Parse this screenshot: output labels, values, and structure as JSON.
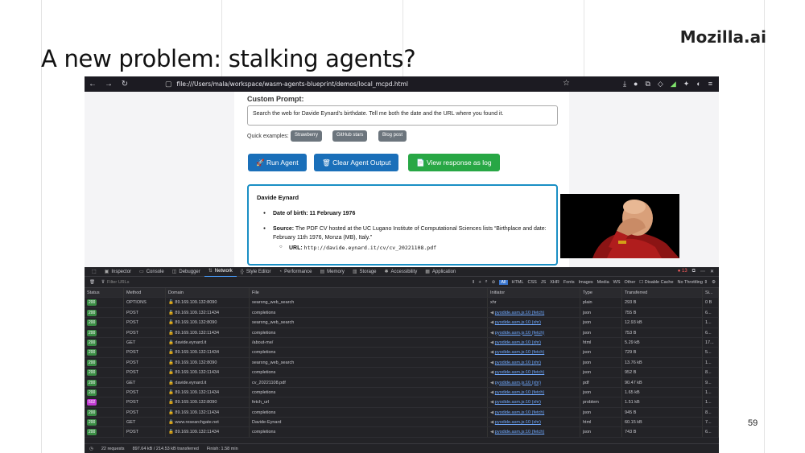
{
  "slide": {
    "title": "A new problem: stalking agents?",
    "logo": "Mozilla.ai",
    "page_number": "59"
  },
  "browser": {
    "url": "file:///Users/mala/workspace/wasm-agents-blueprint/demos/local_mcpd.html"
  },
  "app": {
    "prompt_label": "Custom Prompt:",
    "prompt_value": "Search the web for Davide Eynard's birthdate. Tell me both the date and the URL where you found it.",
    "quick_label": "Quick examples:",
    "quick_examples": [
      "Strawberry",
      "GitHub stars",
      "Blog post"
    ],
    "run_agent": "🚀 Run Agent",
    "clear_output": "🗑 Clear Agent Output",
    "view_log": "📄 View response as log",
    "output": {
      "name": "Davide Eynard",
      "dob_label": "Date of birth:",
      "dob_value": "11 February 1976",
      "source_label": "Source:",
      "source_text": "The PDF CV hosted at the UC Lugano Institute of Computational Sciences lists “Birthplace and date: February 11th 1976, Monza (MB), Italy.”",
      "url_label": "URL:",
      "url_value": "http://davide.eynard.it/cv/cv_20221108.pdf"
    }
  },
  "devtools": {
    "tabs": [
      "Inspector",
      "Console",
      "Debugger",
      "Network",
      "Style Editor",
      "Performance",
      "Memory",
      "Storage",
      "Accessibility",
      "Application"
    ],
    "active_tab": "Network",
    "error_count": "13",
    "filter_placeholder": "Filter URLs",
    "filter_types": [
      "All",
      "HTML",
      "CSS",
      "JS",
      "XHR",
      "Fonts",
      "Images",
      "Media",
      "WS",
      "Other"
    ],
    "disable_cache": "Disable Cache",
    "throttling": "No Throttling ⇕",
    "columns": [
      "Status",
      "Method",
      "Domain",
      "File",
      "Initiator",
      "Type",
      "Transferred",
      "Si..."
    ],
    "rows": [
      {
        "status": "200",
        "method": "OPTIONS",
        "domain": "89.169.109.132:8090",
        "file": "searxng_web_search",
        "initiator": "xhr",
        "type": "plain",
        "transferred": "293 B",
        "size": "0 B"
      },
      {
        "status": "200",
        "method": "POST",
        "domain": "89.169.109.132:11434",
        "file": "completions",
        "initiator": "pyodide.asm.js:10 (fetch)",
        "type": "json",
        "transferred": "755 B",
        "size": "6..."
      },
      {
        "status": "200",
        "method": "POST",
        "domain": "89.169.109.132:8090",
        "file": "searxng_web_search",
        "initiator": "pyodide.asm.js:10 (xhr)",
        "type": "json",
        "transferred": "12.93 kB",
        "size": "1..."
      },
      {
        "status": "200",
        "method": "POST",
        "domain": "89.169.109.132:11434",
        "file": "completions",
        "initiator": "pyodide.asm.js:10 (fetch)",
        "type": "json",
        "transferred": "753 B",
        "size": "6..."
      },
      {
        "status": "200",
        "method": "GET",
        "domain": "davide.eynard.it",
        "file": "/about-me/",
        "initiator": "pyodide.asm.js:10 (xhr)",
        "type": "html",
        "transferred": "5.29 kB",
        "size": "17..."
      },
      {
        "status": "200",
        "method": "POST",
        "domain": "89.169.109.132:11434",
        "file": "completions",
        "initiator": "pyodide.asm.js:10 (fetch)",
        "type": "json",
        "transferred": "729 B",
        "size": "5..."
      },
      {
        "status": "200",
        "method": "POST",
        "domain": "89.169.109.132:8090",
        "file": "searxng_web_search",
        "initiator": "pyodide.asm.js:10 (xhr)",
        "type": "json",
        "transferred": "13.76 kB",
        "size": "1..."
      },
      {
        "status": "200",
        "method": "POST",
        "domain": "89.169.109.132:11434",
        "file": "completions",
        "initiator": "pyodide.asm.js:10 (fetch)",
        "type": "json",
        "transferred": "952 B",
        "size": "8..."
      },
      {
        "status": "200",
        "method": "GET",
        "domain": "davide.eynard.it",
        "file": "cv_20221108.pdf",
        "initiator": "pyodide.asm.js:10 (xhr)",
        "type": "pdf",
        "transferred": "90.47 kB",
        "size": "9..."
      },
      {
        "status": "200",
        "method": "POST",
        "domain": "89.169.109.132:11434",
        "file": "completions",
        "initiator": "pyodide.asm.js:10 (fetch)",
        "type": "json",
        "transferred": "1.65 kB",
        "size": "1..."
      },
      {
        "status": "502",
        "method": "POST",
        "domain": "89.169.109.132:8090",
        "file": "fetch_url",
        "initiator": "pyodide.asm.js:10 (xhr)",
        "type": "problem",
        "transferred": "1.51 kB",
        "size": "1..."
      },
      {
        "status": "200",
        "method": "POST",
        "domain": "89.169.109.132:11434",
        "file": "completions",
        "initiator": "pyodide.asm.js:10 (fetch)",
        "type": "json",
        "transferred": "945 B",
        "size": "8..."
      },
      {
        "status": "200",
        "method": "GET",
        "domain": "www.researchgate.net",
        "file": "Davide-Eynard",
        "initiator": "pyodide.asm.js:10 (xhr)",
        "type": "html",
        "transferred": "60.15 kB",
        "size": "7..."
      },
      {
        "status": "200",
        "method": "POST",
        "domain": "89.169.109.132:11434",
        "file": "completions",
        "initiator": "pyodide.asm.js:10 (fetch)",
        "type": "json",
        "transferred": "743 B",
        "size": "6..."
      }
    ],
    "summary": {
      "requests": "22 requests",
      "transferred": "897.64 kB / 214.53 kB transferred",
      "finish": "Finish: 1.58 min"
    }
  }
}
